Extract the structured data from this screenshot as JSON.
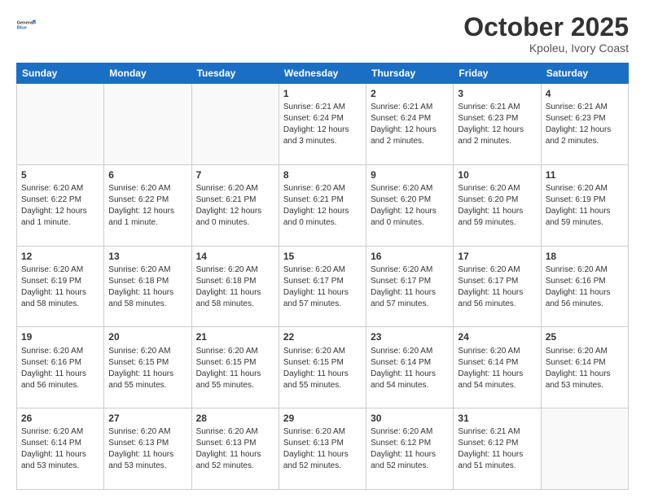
{
  "header": {
    "logo_line1": "General",
    "logo_line2": "Blue",
    "month": "October 2025",
    "location": "Kpoleu, Ivory Coast"
  },
  "weekdays": [
    "Sunday",
    "Monday",
    "Tuesday",
    "Wednesday",
    "Thursday",
    "Friday",
    "Saturday"
  ],
  "weeks": [
    [
      {
        "day": "",
        "info": ""
      },
      {
        "day": "",
        "info": ""
      },
      {
        "day": "",
        "info": ""
      },
      {
        "day": "1",
        "info": "Sunrise: 6:21 AM\nSunset: 6:24 PM\nDaylight: 12 hours and 3 minutes."
      },
      {
        "day": "2",
        "info": "Sunrise: 6:21 AM\nSunset: 6:24 PM\nDaylight: 12 hours and 2 minutes."
      },
      {
        "day": "3",
        "info": "Sunrise: 6:21 AM\nSunset: 6:23 PM\nDaylight: 12 hours and 2 minutes."
      },
      {
        "day": "4",
        "info": "Sunrise: 6:21 AM\nSunset: 6:23 PM\nDaylight: 12 hours and 2 minutes."
      }
    ],
    [
      {
        "day": "5",
        "info": "Sunrise: 6:20 AM\nSunset: 6:22 PM\nDaylight: 12 hours and 1 minute."
      },
      {
        "day": "6",
        "info": "Sunrise: 6:20 AM\nSunset: 6:22 PM\nDaylight: 12 hours and 1 minute."
      },
      {
        "day": "7",
        "info": "Sunrise: 6:20 AM\nSunset: 6:21 PM\nDaylight: 12 hours and 0 minutes."
      },
      {
        "day": "8",
        "info": "Sunrise: 6:20 AM\nSunset: 6:21 PM\nDaylight: 12 hours and 0 minutes."
      },
      {
        "day": "9",
        "info": "Sunrise: 6:20 AM\nSunset: 6:20 PM\nDaylight: 12 hours and 0 minutes."
      },
      {
        "day": "10",
        "info": "Sunrise: 6:20 AM\nSunset: 6:20 PM\nDaylight: 11 hours and 59 minutes."
      },
      {
        "day": "11",
        "info": "Sunrise: 6:20 AM\nSunset: 6:19 PM\nDaylight: 11 hours and 59 minutes."
      }
    ],
    [
      {
        "day": "12",
        "info": "Sunrise: 6:20 AM\nSunset: 6:19 PM\nDaylight: 11 hours and 58 minutes."
      },
      {
        "day": "13",
        "info": "Sunrise: 6:20 AM\nSunset: 6:18 PM\nDaylight: 11 hours and 58 minutes."
      },
      {
        "day": "14",
        "info": "Sunrise: 6:20 AM\nSunset: 6:18 PM\nDaylight: 11 hours and 58 minutes."
      },
      {
        "day": "15",
        "info": "Sunrise: 6:20 AM\nSunset: 6:17 PM\nDaylight: 11 hours and 57 minutes."
      },
      {
        "day": "16",
        "info": "Sunrise: 6:20 AM\nSunset: 6:17 PM\nDaylight: 11 hours and 57 minutes."
      },
      {
        "day": "17",
        "info": "Sunrise: 6:20 AM\nSunset: 6:17 PM\nDaylight: 11 hours and 56 minutes."
      },
      {
        "day": "18",
        "info": "Sunrise: 6:20 AM\nSunset: 6:16 PM\nDaylight: 11 hours and 56 minutes."
      }
    ],
    [
      {
        "day": "19",
        "info": "Sunrise: 6:20 AM\nSunset: 6:16 PM\nDaylight: 11 hours and 56 minutes."
      },
      {
        "day": "20",
        "info": "Sunrise: 6:20 AM\nSunset: 6:15 PM\nDaylight: 11 hours and 55 minutes."
      },
      {
        "day": "21",
        "info": "Sunrise: 6:20 AM\nSunset: 6:15 PM\nDaylight: 11 hours and 55 minutes."
      },
      {
        "day": "22",
        "info": "Sunrise: 6:20 AM\nSunset: 6:15 PM\nDaylight: 11 hours and 55 minutes."
      },
      {
        "day": "23",
        "info": "Sunrise: 6:20 AM\nSunset: 6:14 PM\nDaylight: 11 hours and 54 minutes."
      },
      {
        "day": "24",
        "info": "Sunrise: 6:20 AM\nSunset: 6:14 PM\nDaylight: 11 hours and 54 minutes."
      },
      {
        "day": "25",
        "info": "Sunrise: 6:20 AM\nSunset: 6:14 PM\nDaylight: 11 hours and 53 minutes."
      }
    ],
    [
      {
        "day": "26",
        "info": "Sunrise: 6:20 AM\nSunset: 6:14 PM\nDaylight: 11 hours and 53 minutes."
      },
      {
        "day": "27",
        "info": "Sunrise: 6:20 AM\nSunset: 6:13 PM\nDaylight: 11 hours and 53 minutes."
      },
      {
        "day": "28",
        "info": "Sunrise: 6:20 AM\nSunset: 6:13 PM\nDaylight: 11 hours and 52 minutes."
      },
      {
        "day": "29",
        "info": "Sunrise: 6:20 AM\nSunset: 6:13 PM\nDaylight: 11 hours and 52 minutes."
      },
      {
        "day": "30",
        "info": "Sunrise: 6:20 AM\nSunset: 6:12 PM\nDaylight: 11 hours and 52 minutes."
      },
      {
        "day": "31",
        "info": "Sunrise: 6:21 AM\nSunset: 6:12 PM\nDaylight: 11 hours and 51 minutes."
      },
      {
        "day": "",
        "info": ""
      }
    ]
  ]
}
